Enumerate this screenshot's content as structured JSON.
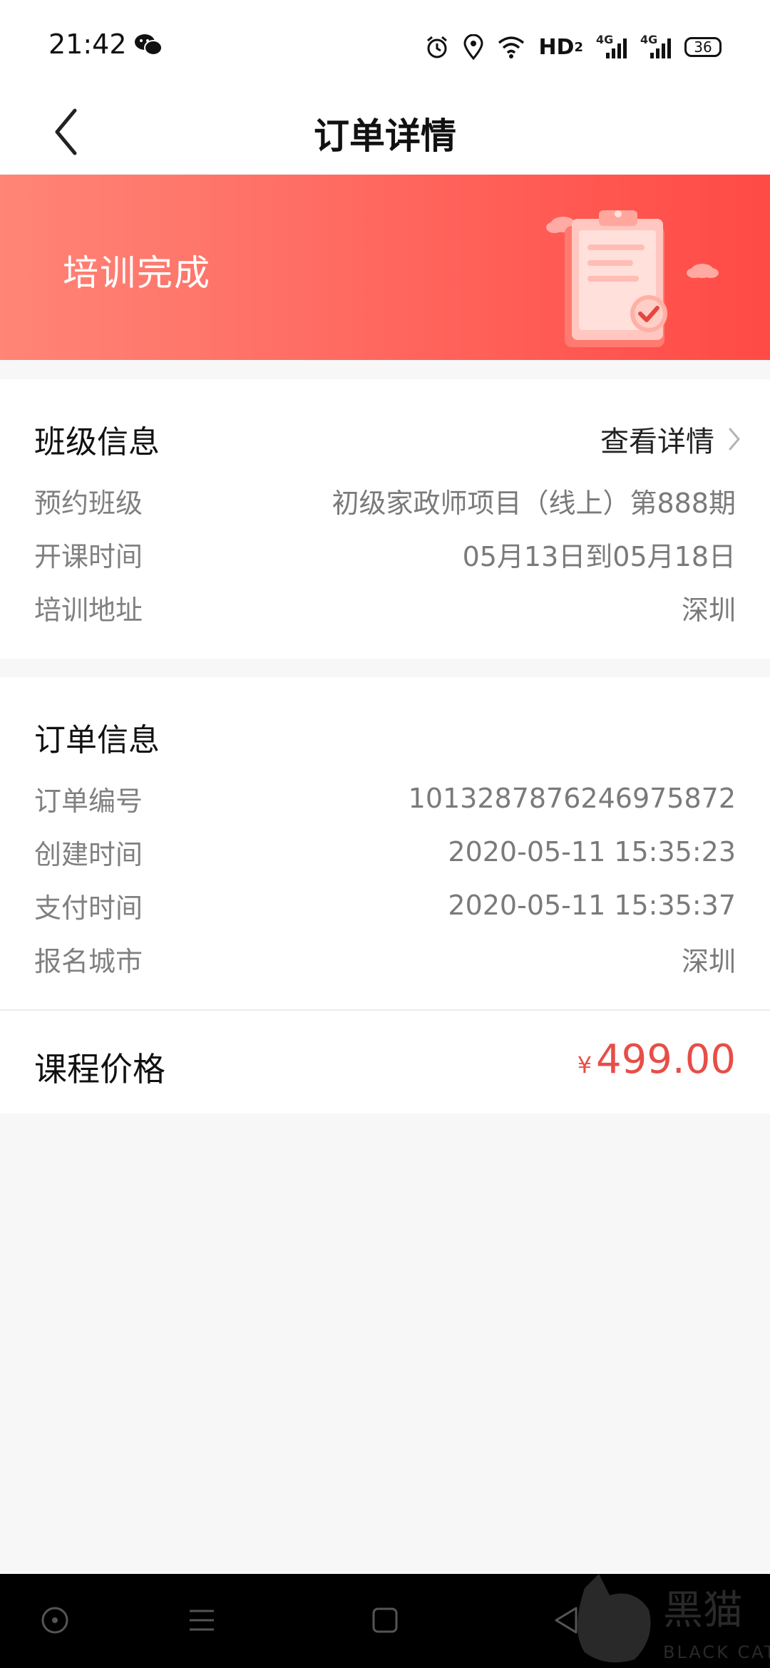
{
  "status_bar": {
    "time": "21:42",
    "icons": [
      "wechat-icon",
      "alarm-icon",
      "location-icon",
      "wifi-icon",
      "hd-icon",
      "signal-4g-icon",
      "signal-4g-icon",
      "battery-icon"
    ],
    "hd_label": "HD",
    "hd_sub": "2",
    "signal_label": "4G",
    "battery": "36"
  },
  "header": {
    "title": "订单详情",
    "back_icon": "chevron-left-icon"
  },
  "banner": {
    "status": "培训完成",
    "illustration": "clipboard-check-icon",
    "colors": {
      "start": "#ff8577",
      "end": "#ff4a45"
    }
  },
  "class_info": {
    "title": "班级信息",
    "detail_link": "查看详情",
    "rows": [
      {
        "label": "预约班级",
        "value": "初级家政师项目（线上）第888期"
      },
      {
        "label": "开课时间",
        "value": "05月13日到05月18日"
      },
      {
        "label": "培训地址",
        "value": "深圳"
      }
    ]
  },
  "order_info": {
    "title": "订单信息",
    "rows": [
      {
        "label": "订单编号",
        "value": "1013287876246975872"
      },
      {
        "label": "创建时间",
        "value": "2020-05-11 15:35:23"
      },
      {
        "label": "支付时间",
        "value": "2020-05-11 15:35:37"
      },
      {
        "label": "报名城市",
        "value": "深圳"
      }
    ]
  },
  "price": {
    "label": "课程价格",
    "currency": "¥",
    "amount": "499.00",
    "color": "#e84d47"
  },
  "watermark": {
    "brand": "黑猫",
    "sub": "BLACK CAT"
  }
}
